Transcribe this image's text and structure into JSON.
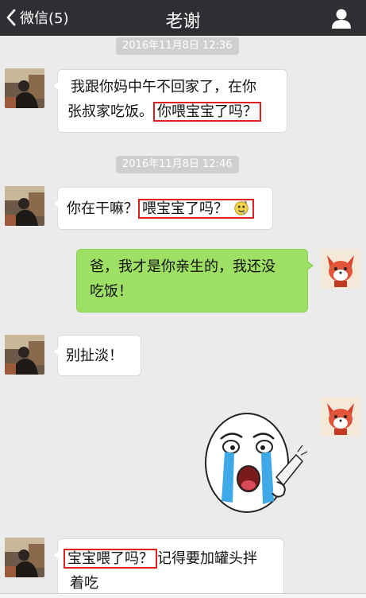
{
  "topbar": {
    "back_label": "微信(5)",
    "title": "老谢",
    "bg": "#2e2e33"
  },
  "timestamps": [
    "2016年11月8日 12:36",
    "2016年11月8日 12:46"
  ],
  "messages": [
    {
      "from": "contact",
      "text_a": "我跟你妈中午不回家了，在你",
      "text_b": "张叔家吃饭。",
      "text_hl": "你喂宝宝了吗？"
    },
    {
      "from": "contact",
      "text_a": "你在干嘛？",
      "text_hl": "喂宝宝了吗？",
      "emoji": "drool-emoji"
    },
    {
      "from": "me",
      "line1": "爸，我才是你亲生的，我还没",
      "line2": "吃饭！"
    },
    {
      "from": "contact",
      "text": "别扯淡！"
    },
    {
      "from": "me",
      "sticker": "crying-face-sticker"
    },
    {
      "from": "contact",
      "text_hl": "宝宝喂了吗？",
      "text_after": "记得要加罐头拌",
      "line2": "着吃"
    }
  ],
  "colors": {
    "bubble_me": "#9ee063",
    "bubble_contact": "#ffffff",
    "highlight": "#e02020",
    "chat_bg": "#ebebeb"
  }
}
